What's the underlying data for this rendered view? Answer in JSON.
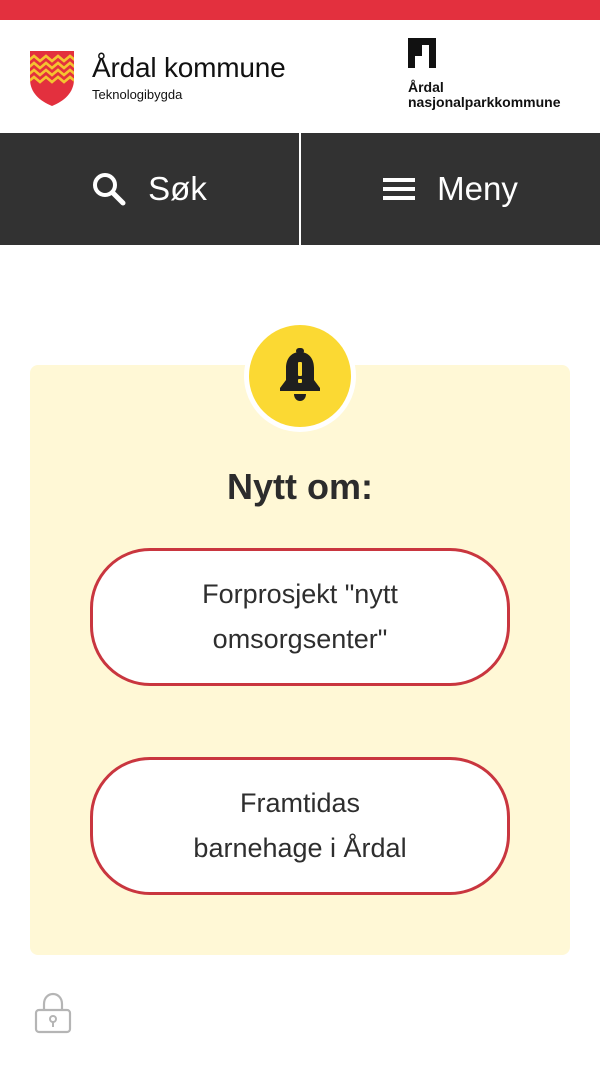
{
  "header": {
    "brand_name": "Årdal kommune",
    "brand_tagline": "Teknologibygda",
    "park_line1": "Årdal",
    "park_line2": "nasjonalparkkommune"
  },
  "nav": {
    "search_label": "Søk",
    "menu_label": "Meny"
  },
  "notice": {
    "title": "Nytt om:",
    "items": [
      {
        "label": "Forprosjekt \"nytt omsorgsenter\""
      },
      {
        "label": "Framtidas barnehage i Årdal"
      }
    ]
  },
  "colors": {
    "top_bar": "#e3303e",
    "nav_background": "#323232",
    "card_background": "#fff8d6",
    "bell_circle": "#fbd933",
    "button_border": "#c9363f"
  },
  "icons": [
    "coat-of-arms-icon",
    "national-park-logo-icon",
    "search-icon",
    "menu-icon",
    "bell-icon",
    "lock-icon"
  ]
}
